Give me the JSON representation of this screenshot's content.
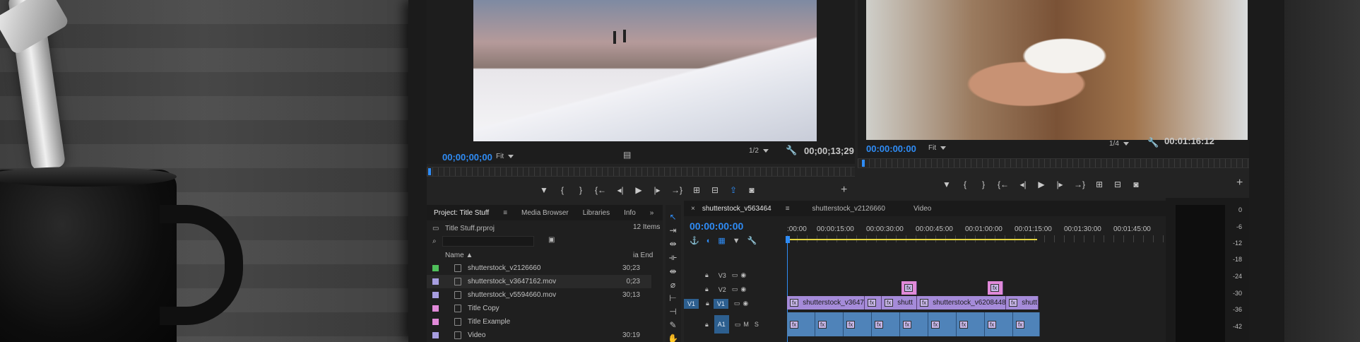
{
  "source_monitor": {
    "timecode_in": "00;00;00;00",
    "zoom": "Fit",
    "resolution": "1/2",
    "timecode_duration": "00;00;13;29"
  },
  "program_monitor": {
    "timecode_in": "00:00:00:00",
    "zoom": "Fit",
    "resolution": "1/4",
    "timecode_duration": "00:01:16:12"
  },
  "transport_icons": [
    "marker-icon",
    "in-point-icon",
    "out-point-icon",
    "go-to-in-icon",
    "step-back-icon",
    "play-icon",
    "step-forward-icon",
    "go-to-out-icon",
    "insert-icon",
    "overwrite-icon",
    "export-frame-icon",
    "camera-icon"
  ],
  "project_panel": {
    "tabs": [
      "Project: Title Stuff",
      "Media Browser",
      "Libraries",
      "Info"
    ],
    "more": "»",
    "file": "Title Stuff.prproj",
    "item_count": "12 Items",
    "columns": {
      "name": "Name",
      "end": "ia End"
    },
    "items": [
      {
        "name": "shutterstock_v2126660",
        "end": "30;23",
        "color": "#4fbf5a"
      },
      {
        "name": "shutterstock_v3647162.mov",
        "end": "0;23",
        "color": "#a79ee0"
      },
      {
        "name": "shutterstock_v5594660.mov",
        "end": "30;13",
        "color": "#a79ee0"
      },
      {
        "name": "Title Copy",
        "end": "",
        "color": "#e18ad9"
      },
      {
        "name": "Title Example",
        "end": "",
        "color": "#e18ad9"
      },
      {
        "name": "Video",
        "end": "30:19",
        "color": "#a79ee0"
      }
    ]
  },
  "timeline": {
    "tabs": [
      "shutterstock_v563464",
      "shutterstock_v2126660",
      "Video"
    ],
    "timecode": "00:00:00:00",
    "ruler": [
      ":00:00",
      "00:00:15:00",
      "00:00:30:00",
      "00:00:45:00",
      "00:01:00:00",
      "00:01:15:00",
      "00:01:30:00",
      "00:01:45:00"
    ],
    "tracks": {
      "v3": "V3",
      "v2": "V2",
      "v1_source": "V1",
      "v1": "V1",
      "a1": "A1",
      "m": "M",
      "s": "S"
    },
    "clips": [
      {
        "label": "shutterstock_v3647",
        "fx": "fx"
      },
      {
        "label": "",
        "fx": "fx"
      },
      {
        "label": "shutt",
        "fx": "fx"
      },
      {
        "label": "shutterstock_v6208448",
        "fx": "fx"
      },
      {
        "label": "shutt",
        "fx": "fx"
      }
    ],
    "fx_label": "fx"
  },
  "audio_meter": [
    "0",
    "-6",
    "-12",
    "-18",
    "-24",
    "-30",
    "-36",
    "-42"
  ]
}
